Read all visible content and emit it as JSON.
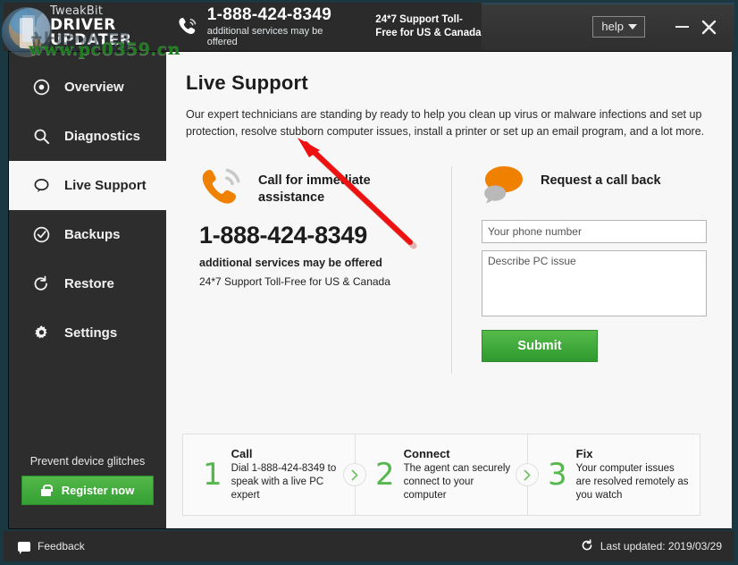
{
  "window": {
    "logo_line1": "TweakBit",
    "logo_line2": "DRIVER UPDATER",
    "header_phone": "1-888-424-8349",
    "header_phone_sub": "additional services may be offered",
    "header_support": "24*7 Support Toll-Free for US & Canada",
    "help_label": "help",
    "minimize_label": "–",
    "close_label": "✕"
  },
  "watermark": {
    "cn_text": "站软件园",
    "url_text": "www.pc0359.cn"
  },
  "sidebar": {
    "items": [
      {
        "label": "Overview",
        "icon": "target-icon",
        "active": false
      },
      {
        "label": "Diagnostics",
        "icon": "search-icon",
        "active": false
      },
      {
        "label": "Live Support",
        "icon": "chat-bubble-icon",
        "active": true
      },
      {
        "label": "Backups",
        "icon": "check-circle-icon",
        "active": false
      },
      {
        "label": "Restore",
        "icon": "restore-arrow-icon",
        "active": false
      },
      {
        "label": "Settings",
        "icon": "gear-icon",
        "active": false
      }
    ],
    "prevent_text": "Prevent device glitches",
    "register_label": "Register now"
  },
  "main": {
    "title": "Live Support",
    "description": "Our expert technicians are standing by ready to help you clean up virus or malware infections and set up protection, resolve stubborn computer issues, install a printer or set up an email program, and a lot more.",
    "call_panel": {
      "heading": "Call for immediate assistance",
      "phone": "1-888-424-8349",
      "sub1": "additional services may be offered",
      "sub2": "24*7 Support Toll-Free for US & Canada"
    },
    "callback_panel": {
      "heading": "Request a call back",
      "phone_placeholder": "Your phone number",
      "phone_value": "",
      "issue_placeholder": "Describe PC issue",
      "issue_value": "",
      "submit_label": "Submit"
    },
    "steps": [
      {
        "num": "1",
        "title": "Call",
        "desc": "Dial 1-888-424-8349 to speak with a live PC expert"
      },
      {
        "num": "2",
        "title": "Connect",
        "desc": "The agent can securely connect to your computer"
      },
      {
        "num": "3",
        "title": "Fix",
        "desc": "Your computer issues are resolved remotely as you watch"
      }
    ]
  },
  "statusbar": {
    "feedback_label": "Feedback",
    "last_updated": "Last updated: 2019/03/29"
  },
  "colors": {
    "accent_green": "#3ba33b",
    "accent_orange": "#f08000",
    "sidebar_bg": "#2d2d2d",
    "main_bg": "#f7f7f7",
    "frame": "#1b3742",
    "annotation_red": "#ee1111"
  }
}
